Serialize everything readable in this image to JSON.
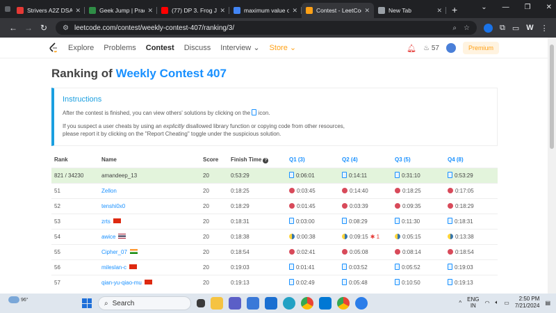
{
  "browser": {
    "tabs": [
      {
        "label": "Strivers A2Z DSA C",
        "favicon_color": "#e53935",
        "active": false
      },
      {
        "label": "Geek Jump | Practi",
        "favicon_color": "#2f8d46",
        "active": false
      },
      {
        "label": "(77) DP 3. Frog Jun",
        "favicon_color": "#ff0000",
        "active": false
      },
      {
        "label": "maximum value of",
        "favicon_color": "#4285f4",
        "active": false
      },
      {
        "label": "Contest - LeetCod",
        "favicon_color": "#ffa116",
        "active": true
      },
      {
        "label": "New Tab",
        "favicon_color": "#9aa0a6",
        "active": false
      }
    ],
    "new_tab": "+",
    "url": "leetcode.com/contest/weekly-contest-407/ranking/3/",
    "profile_letter": "W"
  },
  "nav": {
    "items": [
      "Explore",
      "Problems",
      "Contest",
      "Discuss",
      "Interview",
      "Store"
    ],
    "streak": "57",
    "premium": "Premium"
  },
  "title": {
    "prefix": "Ranking of",
    "contest": "Weekly Contest 407"
  },
  "instructions": {
    "heading": "Instructions",
    "line1_pre": "After the contest is finished, you can view others' solutions by clicking on the",
    "line1_post": "icon.",
    "line2_pre": "If you suspect a user cheats by using an",
    "line2_em": "explicitly",
    "line2_post": "disallowed library function or copying code from other resources,",
    "line3": "please report it by clicking on the \"Report Cheating\" toggle under the suspicious solution."
  },
  "table": {
    "headers": {
      "rank": "Rank",
      "name": "Name",
      "score": "Score",
      "finish": "Finish Time",
      "q1": "Q1 (3)",
      "q2": "Q2 (4)",
      "q3": "Q3 (5)",
      "q4": "Q4 (8)"
    },
    "rows": [
      {
        "rank": "821 / 34230",
        "name": "amandeep_13",
        "flag": "",
        "score": "20",
        "finish": "0:53:29",
        "q1": "0:06:01",
        "q2": "0:14:11",
        "q3": "0:31:10",
        "q4": "0:53:29",
        "langs": [
          "doc",
          "doc",
          "doc",
          "doc"
        ],
        "me": true,
        "q2_bug": ""
      },
      {
        "rank": "51",
        "name": "Zellon",
        "flag": "",
        "score": "20",
        "finish": "0:18:25",
        "q1": "0:03:45",
        "q2": "0:14:40",
        "q3": "0:18:25",
        "q4": "0:17:05",
        "langs": [
          "cpp",
          "cpp",
          "cpp",
          "cpp"
        ],
        "me": false,
        "q2_bug": ""
      },
      {
        "rank": "52",
        "name": "tenshi0x0",
        "flag": "",
        "score": "20",
        "finish": "0:18:29",
        "q1": "0:01:45",
        "q2": "0:03:39",
        "q3": "0:09:35",
        "q4": "0:18:29",
        "langs": [
          "cpp",
          "cpp",
          "cpp",
          "cpp"
        ],
        "me": false,
        "q2_bug": ""
      },
      {
        "rank": "53",
        "name": "zrts",
        "flag": "cn",
        "score": "20",
        "finish": "0:18:31",
        "q1": "0:03:00",
        "q2": "0:08:29",
        "q3": "0:11:30",
        "q4": "0:18:31",
        "langs": [
          "doc",
          "doc",
          "doc",
          "doc"
        ],
        "me": false,
        "q2_bug": ""
      },
      {
        "rank": "54",
        "name": "awice",
        "flag": "th",
        "score": "20",
        "finish": "0:18:38",
        "q1": "0:00:38",
        "q2": "0:09:15",
        "q3": "0:05:15",
        "q4": "0:13:38",
        "langs": [
          "py",
          "py",
          "py",
          "py"
        ],
        "me": false,
        "q2_bug": "1"
      },
      {
        "rank": "55",
        "name": "Cipher_07",
        "flag": "in",
        "score": "20",
        "finish": "0:18:54",
        "q1": "0:02:41",
        "q2": "0:05:08",
        "q3": "0:08:14",
        "q4": "0:18:54",
        "langs": [
          "cpp",
          "cpp",
          "cpp",
          "cpp"
        ],
        "me": false,
        "q2_bug": ""
      },
      {
        "rank": "56",
        "name": "mileslan-c",
        "flag": "cn",
        "score": "20",
        "finish": "0:19:03",
        "q1": "0:01:41",
        "q2": "0:03:52",
        "q3": "0:05:52",
        "q4": "0:19:03",
        "langs": [
          "doc",
          "doc",
          "doc",
          "doc"
        ],
        "me": false,
        "q2_bug": ""
      },
      {
        "rank": "57",
        "name": "qian-yu-qiao-mu",
        "flag": "cn",
        "score": "20",
        "finish": "0:19:13",
        "q1": "0:02:49",
        "q2": "0:05:48",
        "q3": "0:10:50",
        "q4": "0:19:13",
        "langs": [
          "doc",
          "doc",
          "doc",
          "doc"
        ],
        "me": false,
        "q2_bug": ""
      }
    ]
  },
  "taskbar": {
    "weather_temp": "96°",
    "search_placeholder": "Search",
    "lang_top": "ENG",
    "lang_bottom": "IN",
    "time": "2:50 PM",
    "date": "7/21/2024"
  },
  "colors": {
    "accent": "#1890ff",
    "brand": "#ffa116",
    "highlight_row": "#e3f4dc"
  }
}
